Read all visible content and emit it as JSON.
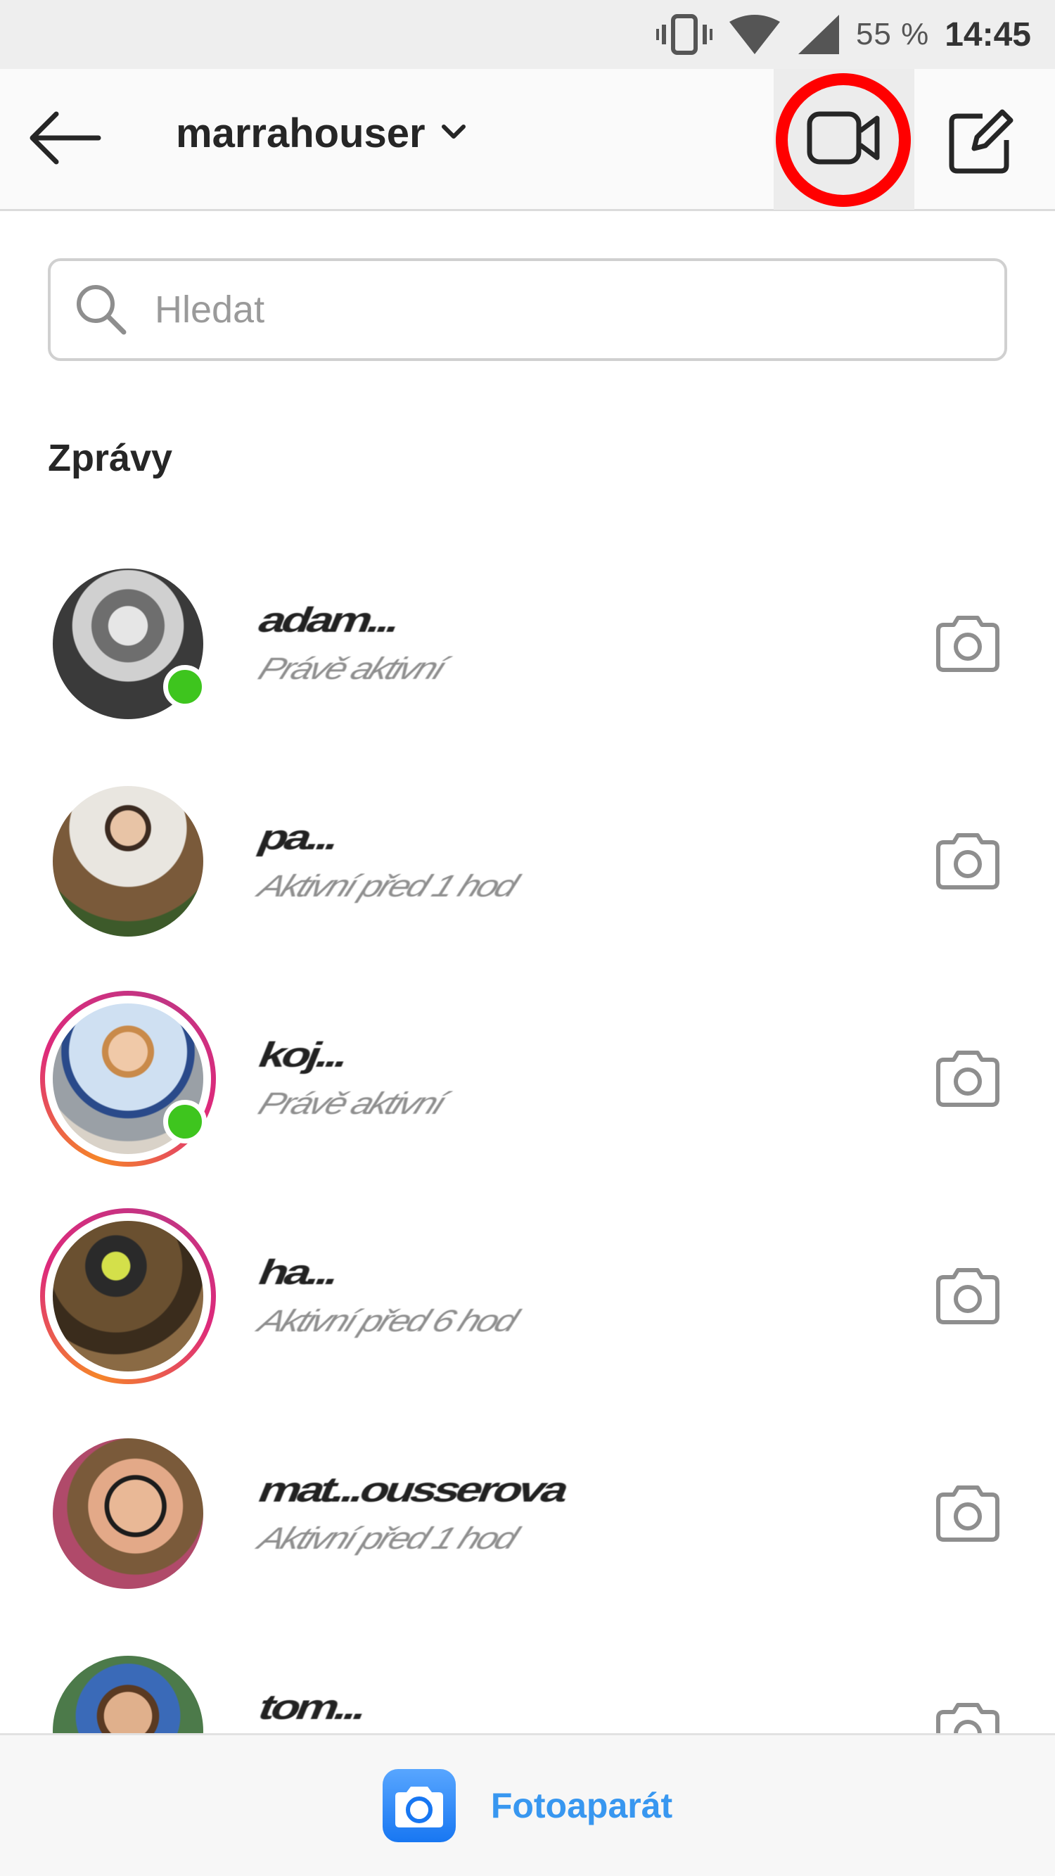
{
  "status_bar": {
    "battery": "55 %",
    "time": "14:45"
  },
  "header": {
    "back_icon": "arrow-left-icon",
    "title": "marrahouser",
    "dropdown_icon": "chevron-down-icon",
    "video_icon": "video-camera-icon",
    "compose_icon": "edit-icon",
    "highlight_color": "#ff0000"
  },
  "search": {
    "placeholder": "Hledat"
  },
  "messages": {
    "section_title": "Zprávy",
    "items": [
      {
        "name": "adam...",
        "status": "Právě aktivní",
        "online": true,
        "story": false,
        "avatar_color": "#777777"
      },
      {
        "name": "pa...",
        "status": "Aktivní před 1 hod",
        "online": false,
        "story": false,
        "avatar_color": "#8a6a4a"
      },
      {
        "name": "koj...",
        "status": "Právě aktivní",
        "online": true,
        "story": true,
        "avatar_color": "#d8c7b5"
      },
      {
        "name": "ha...",
        "status": "Aktivní před 6 hod",
        "online": false,
        "story": true,
        "avatar_color": "#5c4a30"
      },
      {
        "name": "mat...ousserova",
        "status": "Aktivní před 1 hod",
        "online": false,
        "story": false,
        "avatar_color": "#caa17f"
      },
      {
        "name": "tom...",
        "status": "",
        "online": false,
        "story": false,
        "avatar_color": "#4c7a4a"
      }
    ]
  },
  "bottom_bar": {
    "camera_label": "Fotoaparát",
    "accent": "#3897f0"
  }
}
